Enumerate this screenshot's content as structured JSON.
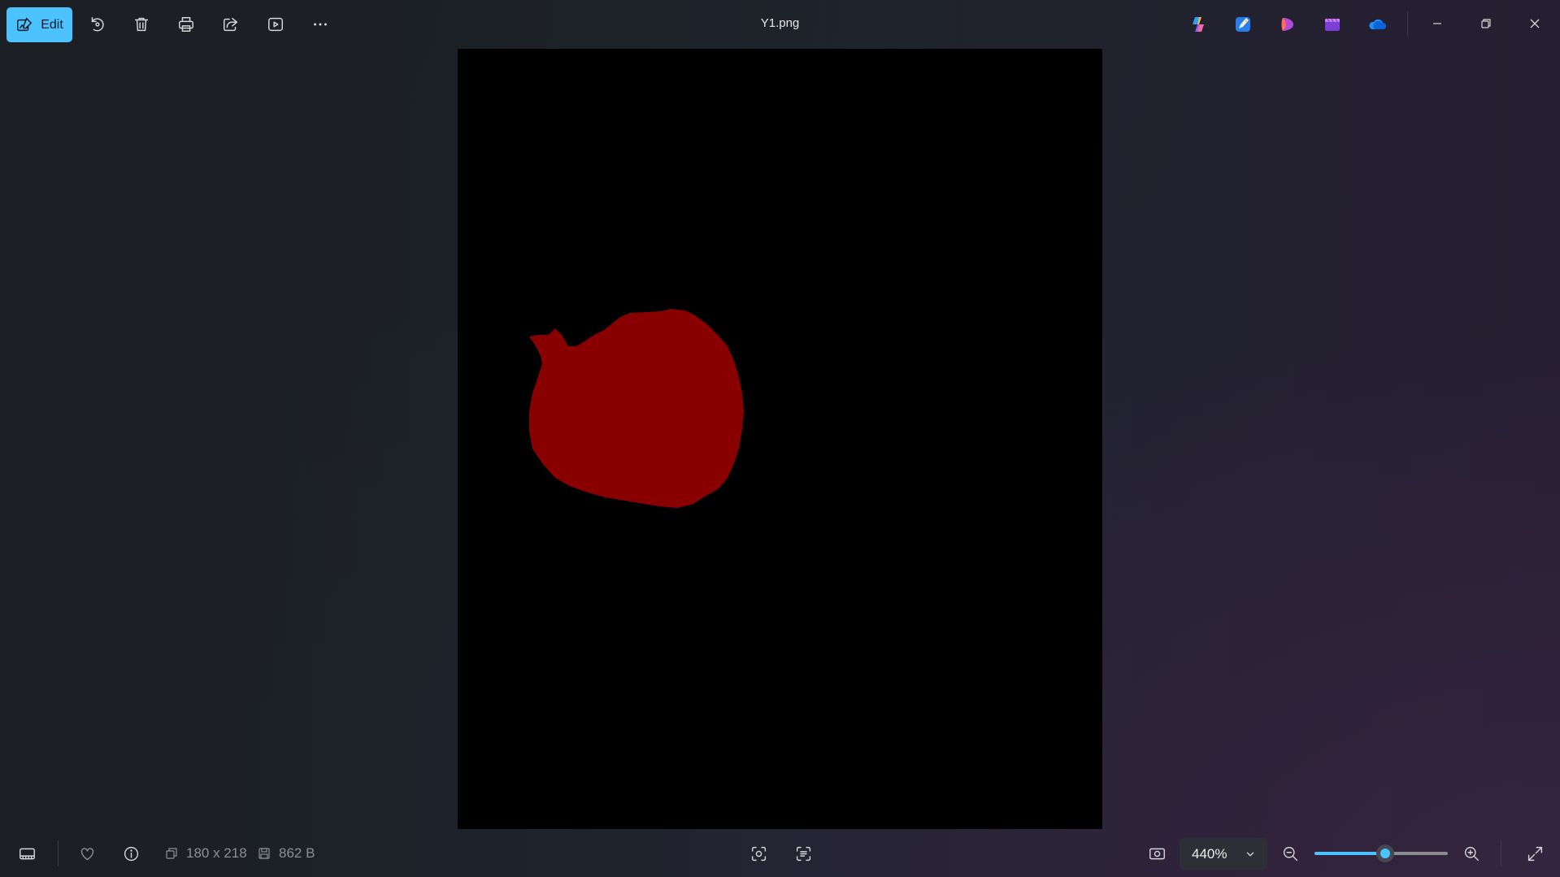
{
  "window": {
    "title": "Y1.png"
  },
  "toolbar": {
    "edit_label": "Edit",
    "tools": [
      "rotate",
      "delete",
      "print",
      "share",
      "slideshow",
      "more"
    ]
  },
  "apps": [
    "copilot",
    "designer",
    "clipchamp",
    "video-editor",
    "onedrive"
  ],
  "image": {
    "background": "#000000",
    "shape_color": "#880000"
  },
  "status": {
    "dimensions": "180 x 218",
    "file_size": "862 B"
  },
  "zoom": {
    "level_label": "440%",
    "slider_fraction": 0.53
  },
  "colors": {
    "accent": "#4cc2ff"
  }
}
